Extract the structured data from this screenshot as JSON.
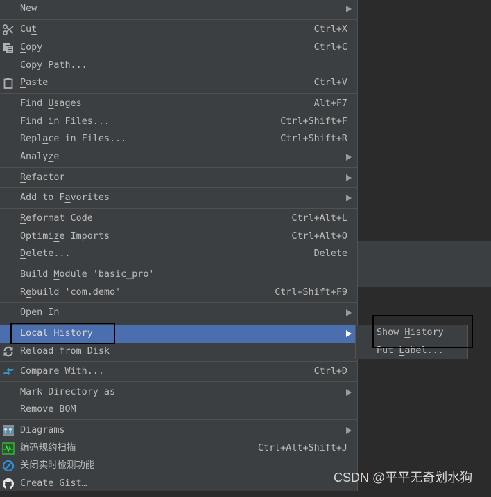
{
  "context_menu": {
    "items": [
      {
        "label": "New",
        "mnemonic": null,
        "shortcut": "",
        "submenu": true,
        "icon": null
      },
      {
        "label": "Cut",
        "mnemonic_index": 2,
        "shortcut": "Ctrl+X",
        "submenu": false,
        "icon": "scissors-icon"
      },
      {
        "label": "Copy",
        "mnemonic_index": 0,
        "shortcut": "Ctrl+C",
        "submenu": false,
        "icon": "copy-icon"
      },
      {
        "label": "Copy Path...",
        "mnemonic_index": null,
        "shortcut": "",
        "submenu": false,
        "icon": null
      },
      {
        "label": "Paste",
        "mnemonic_index": 0,
        "shortcut": "Ctrl+V",
        "submenu": false,
        "icon": "clipboard-icon"
      },
      {
        "label": "Find Usages",
        "mnemonic_index": 5,
        "shortcut": "Alt+F7",
        "submenu": false,
        "icon": null
      },
      {
        "label": "Find in Files...",
        "mnemonic_index": null,
        "shortcut": "Ctrl+Shift+F",
        "submenu": false,
        "icon": null
      },
      {
        "label": "Replace in Files...",
        "mnemonic_index": 4,
        "shortcut": "Ctrl+Shift+R",
        "submenu": false,
        "icon": null
      },
      {
        "label": "Analyze",
        "mnemonic_index": 5,
        "shortcut": "",
        "submenu": true,
        "icon": null
      },
      {
        "label": "Refactor",
        "mnemonic_index": 0,
        "shortcut": "",
        "submenu": true,
        "icon": null
      },
      {
        "label": "Add to Favorites",
        "mnemonic_index": 8,
        "shortcut": "",
        "submenu": true,
        "icon": null
      },
      {
        "label": "Reformat Code",
        "mnemonic_index": 0,
        "shortcut": "Ctrl+Alt+L",
        "submenu": false,
        "icon": null
      },
      {
        "label": "Optimize Imports",
        "mnemonic_index": 6,
        "shortcut": "Ctrl+Alt+O",
        "submenu": false,
        "icon": null
      },
      {
        "label": "Delete...",
        "mnemonic_index": 0,
        "shortcut": "Delete",
        "submenu": false,
        "icon": null
      },
      {
        "label": "Build Module 'basic_pro'",
        "mnemonic_index": 6,
        "shortcut": "",
        "submenu": false,
        "icon": null
      },
      {
        "label": "Rebuild 'com.demo'",
        "mnemonic_index": 1,
        "shortcut": "Ctrl+Shift+F9",
        "submenu": false,
        "icon": null
      },
      {
        "label": "Open In",
        "mnemonic_index": null,
        "shortcut": "",
        "submenu": true,
        "icon": null
      },
      {
        "label": "Local History",
        "mnemonic_index": 6,
        "shortcut": "",
        "submenu": true,
        "icon": null,
        "selected": true
      },
      {
        "label": "Reload from Disk",
        "mnemonic_index": null,
        "shortcut": "",
        "submenu": false,
        "icon": "reload-icon"
      },
      {
        "label": "Compare With...",
        "mnemonic_index": null,
        "shortcut": "Ctrl+D",
        "submenu": false,
        "icon": "compare-icon"
      },
      {
        "label": "Mark Directory as",
        "mnemonic_index": null,
        "shortcut": "",
        "submenu": true,
        "icon": null
      },
      {
        "label": "Remove BOM",
        "mnemonic_index": null,
        "shortcut": "",
        "submenu": false,
        "icon": null
      },
      {
        "label": "Diagrams",
        "mnemonic_index": null,
        "shortcut": "",
        "submenu": true,
        "icon": "diagrams-icon"
      },
      {
        "label": "编码规约扫描",
        "mnemonic_index": null,
        "shortcut": "Ctrl+Alt+Shift+J",
        "submenu": false,
        "icon": "code-scan-icon"
      },
      {
        "label": "关闭实时检测功能",
        "mnemonic_index": null,
        "shortcut": "",
        "submenu": false,
        "icon": "disable-detection-icon"
      },
      {
        "label": "Create Gist…",
        "mnemonic_index": null,
        "shortcut": "",
        "submenu": false,
        "icon": "github-icon"
      }
    ]
  },
  "local_history_submenu": {
    "items": [
      {
        "label": "Show History",
        "mnemonic_index": 5
      },
      {
        "label": "Put Label...",
        "mnemonic_index": 4
      }
    ]
  },
  "watermark": "CSDN @平平无奇划水狗",
  "colors": {
    "menu_bg": "#3c3f41",
    "selection": "#4b6eaf",
    "text": "#bbbbbb",
    "editor_bg": "#2b2b2b"
  }
}
